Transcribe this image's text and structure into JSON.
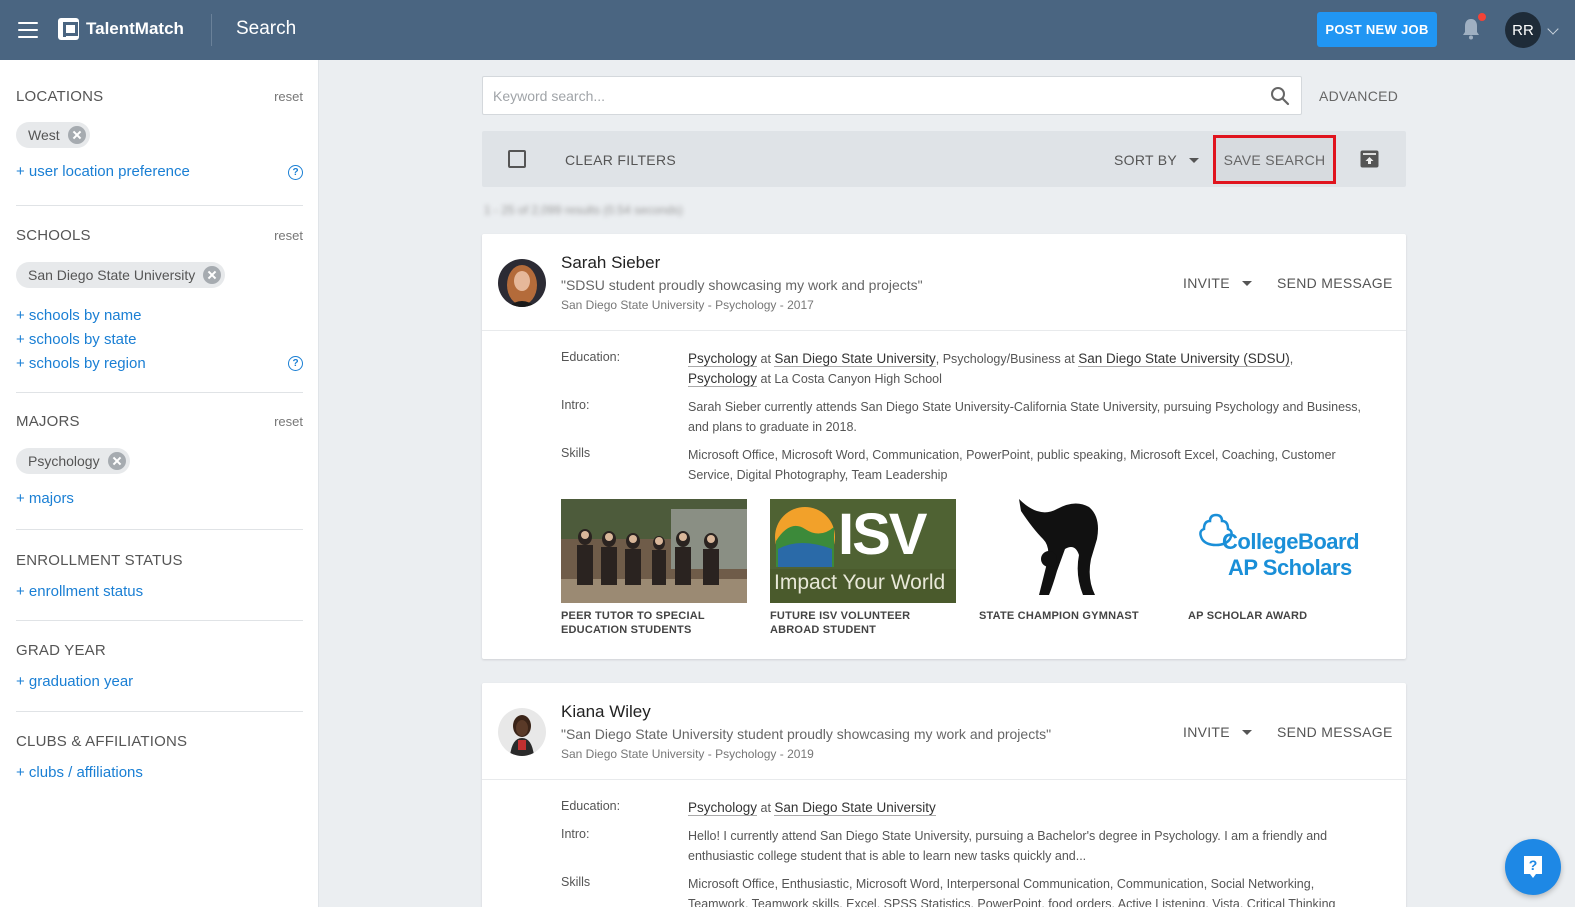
{
  "app": {
    "name": "TalentMatch",
    "page_title": "Search",
    "post_job_label": "POST NEW JOB",
    "user_initials": "RR"
  },
  "colors": {
    "topbar": "#4a6581",
    "accent_blue": "#2196f3",
    "link_blue": "#1a7fd4",
    "highlight_red": "#e0141e",
    "notification_red": "#f44336"
  },
  "sidebar": {
    "locations": {
      "title": "LOCATIONS",
      "reset": "reset",
      "chips": [
        "West"
      ],
      "links": [
        "+ user location preference"
      ]
    },
    "schools": {
      "title": "SCHOOLS",
      "reset": "reset",
      "chips": [
        "San Diego State University"
      ],
      "links": [
        "+ schools by name",
        "+ schools by state",
        "+ schools by region"
      ]
    },
    "majors": {
      "title": "MAJORS",
      "reset": "reset",
      "chips": [
        "Psychology"
      ],
      "links": [
        "+ majors"
      ]
    },
    "enrollment": {
      "title": "ENROLLMENT STATUS",
      "link": "+ enrollment status"
    },
    "grad_year": {
      "title": "GRAD YEAR",
      "link": "+ graduation year"
    },
    "clubs": {
      "title": "CLUBS & AFFILIATIONS",
      "link": "+ clubs / affiliations"
    }
  },
  "search": {
    "placeholder": "Keyword search...",
    "value": "",
    "advanced_label": "ADVANCED"
  },
  "filterbar": {
    "clear_filters": "CLEAR FILTERS",
    "sort_by": "SORT BY",
    "save_search": "SAVE SEARCH",
    "results_text": "1 - 25 of 2,099 results (0.54 seconds)"
  },
  "results": [
    {
      "name": "Sarah Sieber",
      "tagline": "\"SDSU student proudly showcasing my work and projects\"",
      "meta": "San Diego State University - Psychology - 2017",
      "invite": "INVITE",
      "send_message": "SEND MESSAGE",
      "labels": {
        "education": "Education:",
        "intro": "Intro:",
        "skills": "Skills"
      },
      "education": {
        "major1": "Psychology",
        "at1": " at ",
        "school1": "San Diego State University",
        "mid": ", Psychology/Business at ",
        "school2": "San Diego State University (SDSU)",
        "comma": ",",
        "major3": "Psychology",
        "tail3": " at La Costa Canyon High School"
      },
      "intro": "Sarah Sieber currently attends San Diego State University-California State University, pursuing Psychology and Business, and plans to graduate in 2018.",
      "skills": "Microsoft Office, Microsoft Word, Communication, PowerPoint, public speaking, Microsoft Excel, Coaching, Customer Service, Digital Photography, Team Leadership",
      "portfolio": [
        {
          "caption": "PEER TUTOR TO SPECIAL EDUCATION STUDENTS"
        },
        {
          "caption": "FUTURE ISV VOLUNTEER ABROAD STUDENT",
          "logo_text": "ISV",
          "logo_sub": "Impact Your World"
        },
        {
          "caption": "STATE CHAMPION GYMNAST"
        },
        {
          "caption": "AP SCHOLAR AWARD",
          "logo_line1": "CollegeBoard",
          "logo_line2": "AP Scholars"
        }
      ]
    },
    {
      "name": "Kiana Wiley",
      "tagline": "\"San Diego State University student proudly showcasing my work and projects\"",
      "meta": "San Diego State University - Psychology - 2019",
      "invite": "INVITE",
      "send_message": "SEND MESSAGE",
      "labels": {
        "education": "Education:",
        "intro": "Intro:",
        "skills": "Skills"
      },
      "education": {
        "major1": "Psychology",
        "at1": " at ",
        "school1": "San Diego State University"
      },
      "intro": "Hello! I currently attend San Diego State University, pursuing a Bachelor's degree in Psychology. I am a friendly and enthusiastic college student that is able to learn new tasks quickly and...",
      "skills": "Microsoft Office, Enthusiastic, Microsoft Word, Interpersonal Communication, Communication, Social Networking, Teamwork, Teamwork skills, Excel, SPSS Statistics, PowerPoint, food orders, Active Listening, Vista, Critical Thinking"
    }
  ],
  "icons": [
    "menu-icon",
    "bell-icon",
    "search-icon",
    "archive-icon",
    "help-icon",
    "question-icon"
  ]
}
